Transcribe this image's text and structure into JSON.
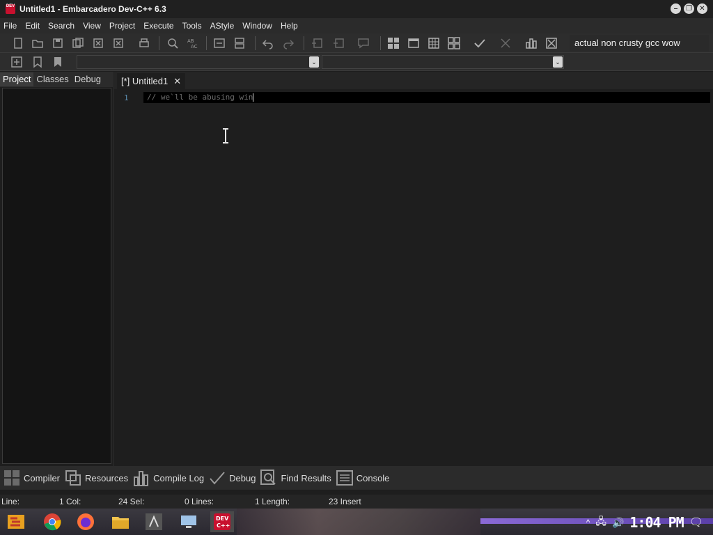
{
  "window": {
    "title": "Untitled1 - Embarcadero Dev-C++ 6.3",
    "app_icon_text": "DEV"
  },
  "menubar": {
    "items": [
      "File",
      "Edit",
      "Search",
      "View",
      "Project",
      "Execute",
      "Tools",
      "AStyle",
      "Window",
      "Help"
    ]
  },
  "toolbar": {
    "compiler_name": "actual non crusty gcc wow"
  },
  "left_panel": {
    "tabs": [
      "Project",
      "Classes",
      "Debug"
    ],
    "active_tab": "Project"
  },
  "editor": {
    "tab_label": "[*] Untitled1",
    "tab_close": "✕",
    "line_number": "1",
    "code": "// we`ll be abusing win"
  },
  "bottom_tabs": [
    "Compiler",
    "Resources",
    "Compile Log",
    "Debug",
    "Find Results",
    "Console"
  ],
  "statusbar": {
    "line": "Line:",
    "line_val": "1 Col:",
    "col_val": "24 Sel:",
    "sel_val": "0 Lines:",
    "lines_val": "1 Length:",
    "length_val": "23 Insert"
  },
  "taskbar": {
    "clock": "1:04 PM",
    "devcpp_label": "DEV C++"
  },
  "colors": {
    "accent": "#c8102e",
    "editor_bg": "#1e1e1e",
    "line_number": "#5c8fb3"
  }
}
